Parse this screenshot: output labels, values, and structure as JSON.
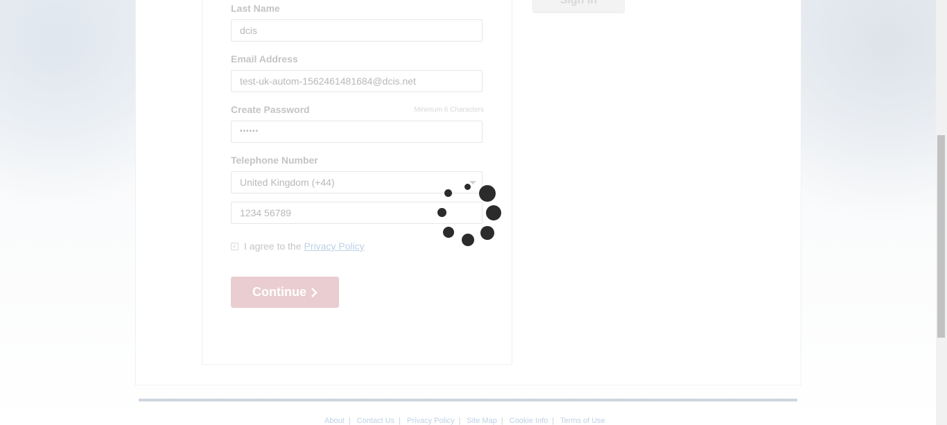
{
  "form": {
    "last_name_label": "Last Name",
    "last_name_value": "dcis",
    "email_label": "Email Address",
    "email_value": "test-uk-autom-1562461481684@dcis.net",
    "password_label": "Create Password",
    "password_hint": "Minimum 6 Characters",
    "password_value": "••••••",
    "telephone_label": "Telephone Number",
    "country_value": "United Kingdom (+44)",
    "phone_placeholder": "1234 56789",
    "agree_text": "I agree to the",
    "privacy_link": "Privacy Policy",
    "continue_label": "Continue",
    "continue_icon": "chevron-right-icon",
    "agree_checked": true
  },
  "sidebar": {
    "signin_label": "Sign in"
  },
  "footer": {
    "links": [
      "About",
      "Contact Us",
      "Privacy Policy",
      "Site Map",
      "Cookie Info",
      "Terms of Use"
    ]
  },
  "loading": {
    "spinner_icon": "loading-spinner-icon"
  },
  "colors": {
    "continue_bg": "#e9cdd0",
    "link": "#bcd0e6"
  }
}
